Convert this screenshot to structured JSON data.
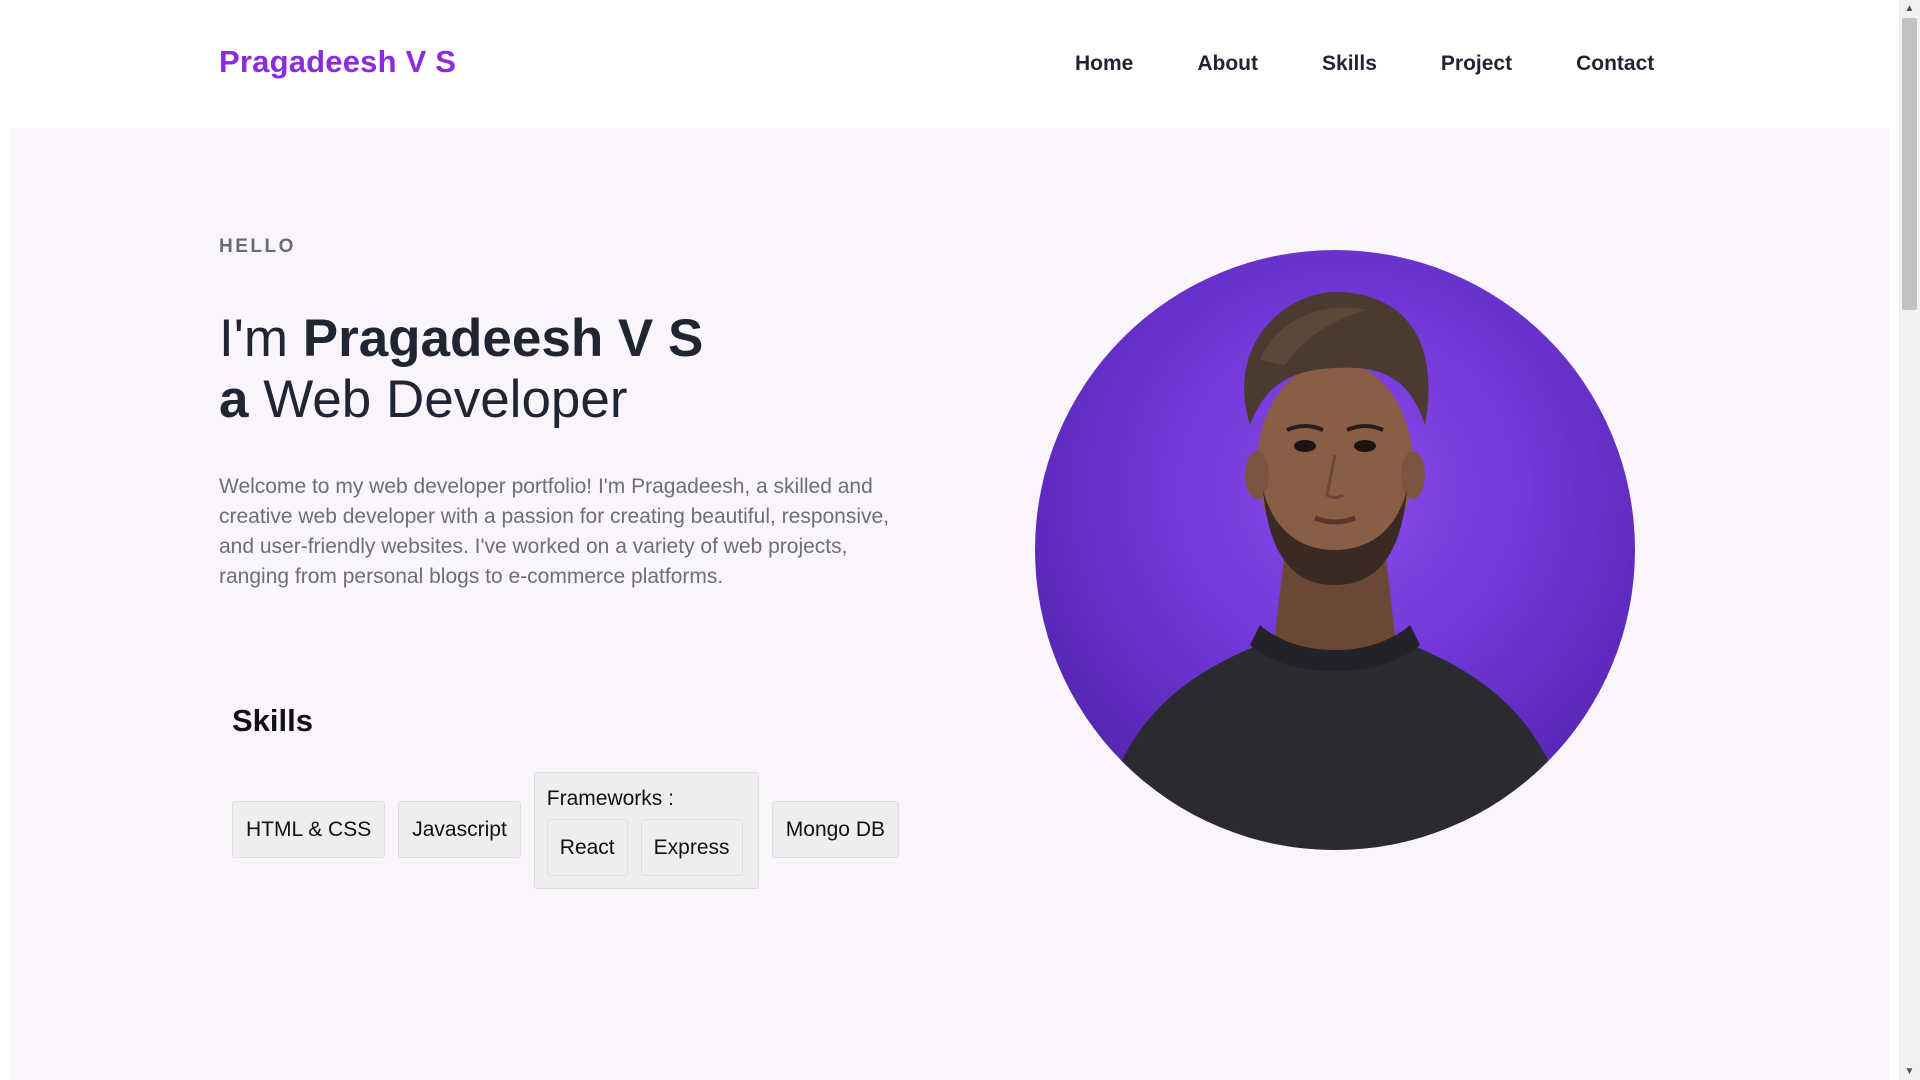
{
  "header": {
    "logo": "Pragadeesh V S",
    "nav": [
      "Home",
      "About",
      "Skills",
      "Project",
      "Contact"
    ]
  },
  "hero": {
    "greeting": "HELLO",
    "headline_prefix": "I'm ",
    "headline_name": "Pragadeesh V S",
    "headline_article": "a",
    "headline_role": " Web Developer",
    "intro": "Welcome to my web developer portfolio! I'm Pragadeesh, a skilled and creative web developer with a passion for creating beautiful, responsive, and user-friendly websites. I've worked on a variety of web projects, ranging from personal blogs to e-commerce platforms.",
    "portrait_icon": "profile-photo"
  },
  "skills": {
    "title": "Skills",
    "html_css": "HTML & CSS",
    "javascript": "Javascript",
    "frameworks_label": "Frameworks :",
    "frameworks": [
      "React",
      "Express"
    ],
    "database": "Mongo DB"
  },
  "scrollbar": {
    "up_icon": "chevron-up-icon",
    "down_icon": "chevron-down-icon"
  },
  "colors": {
    "brand": "#8a2be2",
    "text_dark": "#1f2533",
    "hero_bg": "#faf5fd",
    "portrait_purple": "#7238d8"
  }
}
